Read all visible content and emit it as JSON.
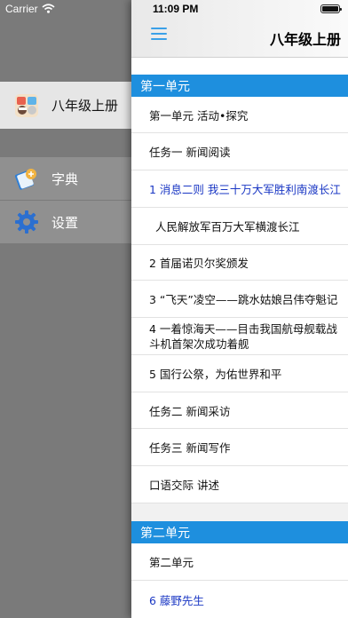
{
  "status": {
    "carrier": "Carrier",
    "time": "11:09 PM"
  },
  "sidebar": {
    "items": [
      {
        "label": "八年级上册"
      },
      {
        "label": "字典"
      },
      {
        "label": "设置"
      }
    ]
  },
  "header": {
    "title": "八年级上册"
  },
  "sections": [
    {
      "title": "第一单元",
      "rows": [
        "第一单元 活动•探究",
        "任务一 新闻阅读",
        "1 消息二则 我三十万大军胜利南渡长江",
        "人民解放军百万大军横渡长江",
        "2 首届诺贝尔奖颁发",
        "3 “飞天”凌空——跳水姑娘吕伟夺魁记",
        "4 一着惊海天——目击我国航母舰载战斗机首架次成功着舰",
        "5 国行公祭，为佑世界和平",
        "任务二 新闻采访",
        "任务三 新闻写作",
        "口语交际 讲述"
      ]
    },
    {
      "title": "第二单元",
      "rows": [
        "第二单元",
        "6 藤野先生"
      ]
    }
  ],
  "colors": {
    "accent": "#1e8fde",
    "link": "#1a37c4"
  }
}
